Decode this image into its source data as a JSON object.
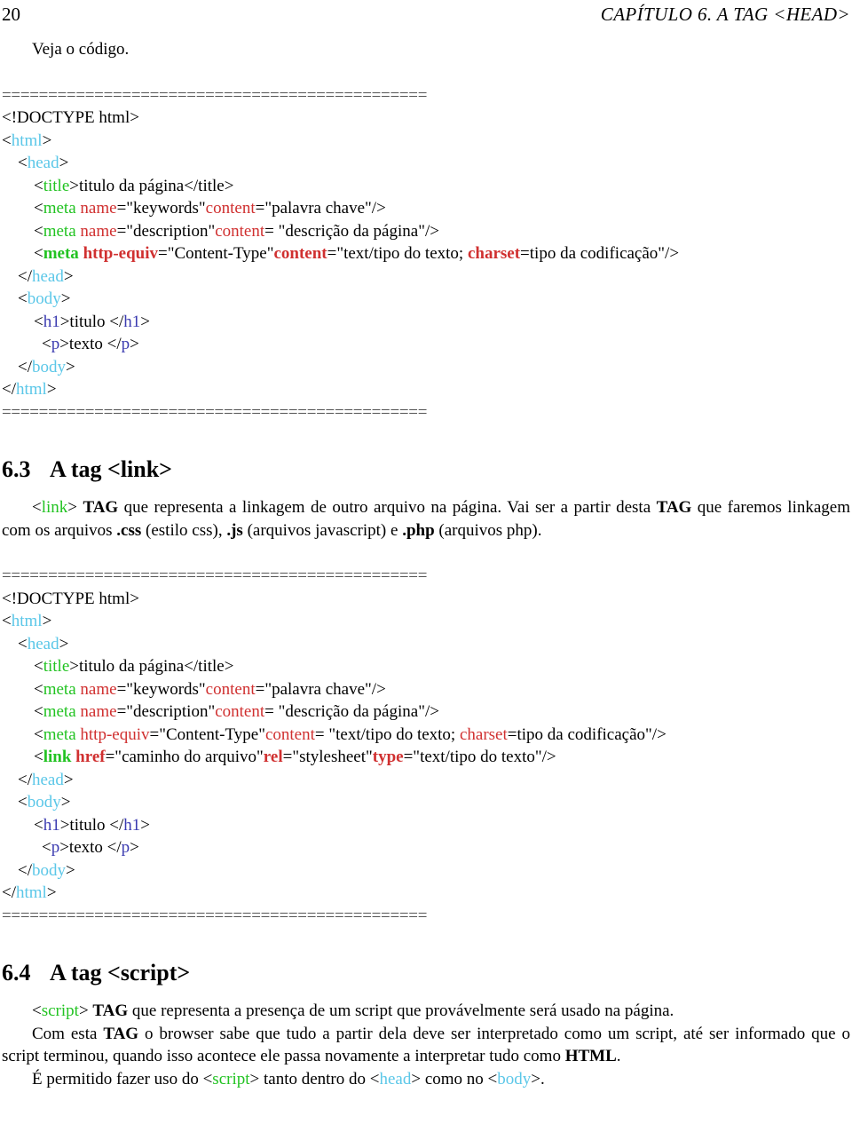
{
  "header": {
    "folio": "20",
    "chapter_title": "CAPÍTULO 6.  A TAG <HEAD>"
  },
  "intro": {
    "text": "Veja o código."
  },
  "separator": "==============================================",
  "code_block_1": {
    "lines": [
      {
        "indent": 0,
        "segments": [
          {
            "text": "<!DOCTYPE html>",
            "color": "black",
            "bold": false
          }
        ]
      },
      {
        "indent": 0,
        "segments": [
          {
            "text": "<",
            "color": "black",
            "bold": false
          },
          {
            "text": "html",
            "color": "cyan",
            "bold": false
          },
          {
            "text": ">",
            "color": "black",
            "bold": false
          }
        ]
      },
      {
        "indent": 1,
        "segments": [
          {
            "text": "<",
            "color": "black",
            "bold": false
          },
          {
            "text": "head",
            "color": "cyan",
            "bold": false
          },
          {
            "text": ">",
            "color": "black",
            "bold": false
          }
        ]
      },
      {
        "indent": 2,
        "segments": [
          {
            "text": "<",
            "color": "black",
            "bold": false
          },
          {
            "text": "title",
            "color": "green",
            "bold": false
          },
          {
            "text": ">titulo da página</title>",
            "color": "black",
            "bold": false
          }
        ]
      },
      {
        "indent": 2,
        "segments": [
          {
            "text": "<",
            "color": "black",
            "bold": false
          },
          {
            "text": "meta ",
            "color": "green",
            "bold": false
          },
          {
            "text": "name",
            "color": "red",
            "bold": false
          },
          {
            "text": "=\"keywords\"",
            "color": "black",
            "bold": false
          },
          {
            "text": "content",
            "color": "red",
            "bold": false
          },
          {
            "text": "=\"palavra chave\"/>",
            "color": "black",
            "bold": false
          }
        ]
      },
      {
        "indent": 2,
        "segments": [
          {
            "text": "<",
            "color": "black",
            "bold": false
          },
          {
            "text": "meta ",
            "color": "green",
            "bold": false
          },
          {
            "text": "name",
            "color": "red",
            "bold": false
          },
          {
            "text": "=\"description\"",
            "color": "black",
            "bold": false
          },
          {
            "text": "content",
            "color": "red",
            "bold": false
          },
          {
            "text": "= \"descrição da página\"/>",
            "color": "black",
            "bold": false
          }
        ]
      },
      {
        "indent": 2,
        "segments": [
          {
            "text": "<",
            "color": "black",
            "bold": false
          },
          {
            "text": "meta ",
            "color": "green",
            "bold": true
          },
          {
            "text": "http-equiv",
            "color": "red",
            "bold": true
          },
          {
            "text": "=\"Content-Type\"",
            "color": "black",
            "bold": false
          },
          {
            "text": "content",
            "color": "red",
            "bold": true
          },
          {
            "text": "=\"text/tipo do texto; ",
            "color": "black",
            "bold": false
          },
          {
            "text": "charset",
            "color": "red",
            "bold": true
          },
          {
            "text": "=tipo da codificação\"/>",
            "color": "black",
            "bold": false
          }
        ]
      },
      {
        "indent": 1,
        "segments": [
          {
            "text": "</",
            "color": "black",
            "bold": false
          },
          {
            "text": "head",
            "color": "cyan",
            "bold": false
          },
          {
            "text": ">",
            "color": "black",
            "bold": false
          }
        ]
      },
      {
        "indent": 1,
        "segments": [
          {
            "text": "<",
            "color": "black",
            "bold": false
          },
          {
            "text": "body",
            "color": "cyan",
            "bold": false
          },
          {
            "text": ">",
            "color": "black",
            "bold": false
          }
        ]
      },
      {
        "indent": 2,
        "segments": [
          {
            "text": "<",
            "color": "black",
            "bold": false
          },
          {
            "text": "h1",
            "color": "blue",
            "bold": false
          },
          {
            "text": ">titulo </",
            "color": "black",
            "bold": false
          },
          {
            "text": "h1",
            "color": "blue",
            "bold": false
          },
          {
            "text": ">",
            "color": "black",
            "bold": false
          }
        ]
      },
      {
        "indent": 2.5,
        "segments": [
          {
            "text": "<",
            "color": "black",
            "bold": false
          },
          {
            "text": "p",
            "color": "blue",
            "bold": false
          },
          {
            "text": ">texto </",
            "color": "black",
            "bold": false
          },
          {
            "text": "p",
            "color": "blue",
            "bold": false
          },
          {
            "text": ">",
            "color": "black",
            "bold": false
          }
        ]
      },
      {
        "indent": 1,
        "segments": [
          {
            "text": "</",
            "color": "black",
            "bold": false
          },
          {
            "text": "body",
            "color": "cyan",
            "bold": false
          },
          {
            "text": ">",
            "color": "black",
            "bold": false
          }
        ]
      },
      {
        "indent": 0,
        "segments": [
          {
            "text": "</",
            "color": "black",
            "bold": false
          },
          {
            "text": "html",
            "color": "cyan",
            "bold": false
          },
          {
            "text": ">",
            "color": "black",
            "bold": false
          }
        ]
      }
    ]
  },
  "section_63": {
    "number": "6.3",
    "title": "A tag <link>",
    "paragraph": [
      {
        "text": "<",
        "color": "black",
        "bold": false
      },
      {
        "text": "link",
        "color": "green",
        "bold": false
      },
      {
        "text": "> ",
        "color": "black",
        "bold": false
      },
      {
        "text": "TAG",
        "color": "black",
        "bold": true
      },
      {
        "text": " que representa a linkagem de outro arquivo na página. Vai ser a partir desta ",
        "color": "black",
        "bold": false
      },
      {
        "text": "TAG",
        "color": "black",
        "bold": true
      },
      {
        "text": " que faremos linkagem com os arquivos ",
        "color": "black",
        "bold": false
      },
      {
        "text": ".css",
        "color": "black",
        "bold": true
      },
      {
        "text": " (estilo css), ",
        "color": "black",
        "bold": false
      },
      {
        "text": ".js",
        "color": "black",
        "bold": true
      },
      {
        "text": " (arquivos javascript) e ",
        "color": "black",
        "bold": false
      },
      {
        "text": ".php",
        "color": "black",
        "bold": true
      },
      {
        "text": " (arquivos php).",
        "color": "black",
        "bold": false
      }
    ]
  },
  "code_block_2": {
    "lines": [
      {
        "indent": 0,
        "segments": [
          {
            "text": "<!DOCTYPE html>",
            "color": "black",
            "bold": false
          }
        ]
      },
      {
        "indent": 0,
        "segments": [
          {
            "text": "<",
            "color": "black",
            "bold": false
          },
          {
            "text": "html",
            "color": "cyan",
            "bold": false
          },
          {
            "text": ">",
            "color": "black",
            "bold": false
          }
        ]
      },
      {
        "indent": 1,
        "segments": [
          {
            "text": "<",
            "color": "black",
            "bold": false
          },
          {
            "text": "head",
            "color": "cyan",
            "bold": false
          },
          {
            "text": ">",
            "color": "black",
            "bold": false
          }
        ]
      },
      {
        "indent": 2,
        "segments": [
          {
            "text": "<",
            "color": "black",
            "bold": false
          },
          {
            "text": "title",
            "color": "green",
            "bold": false
          },
          {
            "text": ">titulo da página</title>",
            "color": "black",
            "bold": false
          }
        ]
      },
      {
        "indent": 2,
        "segments": [
          {
            "text": "<",
            "color": "black",
            "bold": false
          },
          {
            "text": "meta ",
            "color": "green",
            "bold": false
          },
          {
            "text": "name",
            "color": "red",
            "bold": false
          },
          {
            "text": "=\"keywords\"",
            "color": "black",
            "bold": false
          },
          {
            "text": "content",
            "color": "red",
            "bold": false
          },
          {
            "text": "=\"palavra chave\"/>",
            "color": "black",
            "bold": false
          }
        ]
      },
      {
        "indent": 2,
        "segments": [
          {
            "text": "<",
            "color": "black",
            "bold": false
          },
          {
            "text": "meta ",
            "color": "green",
            "bold": false
          },
          {
            "text": "name",
            "color": "red",
            "bold": false
          },
          {
            "text": "=\"description\"",
            "color": "black",
            "bold": false
          },
          {
            "text": "content",
            "color": "red",
            "bold": false
          },
          {
            "text": "= \"descrição da página\"/>",
            "color": "black",
            "bold": false
          }
        ]
      },
      {
        "indent": 2,
        "segments": [
          {
            "text": "<",
            "color": "black",
            "bold": false
          },
          {
            "text": "meta ",
            "color": "green",
            "bold": false
          },
          {
            "text": "http-equiv",
            "color": "red",
            "bold": false
          },
          {
            "text": "=\"Content-Type\"",
            "color": "black",
            "bold": false
          },
          {
            "text": "content",
            "color": "red",
            "bold": false
          },
          {
            "text": "= \"text/tipo do texto; ",
            "color": "black",
            "bold": false
          },
          {
            "text": "charset",
            "color": "red",
            "bold": false
          },
          {
            "text": "=tipo da codificação\"/>",
            "color": "black",
            "bold": false
          }
        ]
      },
      {
        "indent": 2,
        "segments": [
          {
            "text": "<",
            "color": "black",
            "bold": false
          },
          {
            "text": "link ",
            "color": "green",
            "bold": true
          },
          {
            "text": "href",
            "color": "red",
            "bold": true
          },
          {
            "text": "=\"caminho do arquivo\"",
            "color": "black",
            "bold": false
          },
          {
            "text": "rel",
            "color": "red",
            "bold": true
          },
          {
            "text": "=\"stylesheet\"",
            "color": "black",
            "bold": false
          },
          {
            "text": "type",
            "color": "red",
            "bold": true
          },
          {
            "text": "=\"text/tipo do texto\"/>",
            "color": "black",
            "bold": false
          }
        ]
      },
      {
        "indent": 1,
        "segments": [
          {
            "text": "</",
            "color": "black",
            "bold": false
          },
          {
            "text": "head",
            "color": "cyan",
            "bold": false
          },
          {
            "text": ">",
            "color": "black",
            "bold": false
          }
        ]
      },
      {
        "indent": 1,
        "segments": [
          {
            "text": "<",
            "color": "black",
            "bold": false
          },
          {
            "text": "body",
            "color": "cyan",
            "bold": false
          },
          {
            "text": ">",
            "color": "black",
            "bold": false
          }
        ]
      },
      {
        "indent": 2,
        "segments": [
          {
            "text": "<",
            "color": "black",
            "bold": false
          },
          {
            "text": "h1",
            "color": "blue",
            "bold": false
          },
          {
            "text": ">titulo </",
            "color": "black",
            "bold": false
          },
          {
            "text": "h1",
            "color": "blue",
            "bold": false
          },
          {
            "text": ">",
            "color": "black",
            "bold": false
          }
        ]
      },
      {
        "indent": 2.5,
        "segments": [
          {
            "text": "<",
            "color": "black",
            "bold": false
          },
          {
            "text": "p",
            "color": "blue",
            "bold": false
          },
          {
            "text": ">texto </",
            "color": "black",
            "bold": false
          },
          {
            "text": "p",
            "color": "blue",
            "bold": false
          },
          {
            "text": ">",
            "color": "black",
            "bold": false
          }
        ]
      },
      {
        "indent": 1,
        "segments": [
          {
            "text": "</",
            "color": "black",
            "bold": false
          },
          {
            "text": "body",
            "color": "cyan",
            "bold": false
          },
          {
            "text": ">",
            "color": "black",
            "bold": false
          }
        ]
      },
      {
        "indent": 0,
        "segments": [
          {
            "text": "</",
            "color": "black",
            "bold": false
          },
          {
            "text": "html",
            "color": "cyan",
            "bold": false
          },
          {
            "text": ">",
            "color": "black",
            "bold": false
          }
        ]
      }
    ]
  },
  "section_64": {
    "number": "6.4",
    "title": "A tag <script>",
    "paragraph_1": [
      {
        "text": "<",
        "color": "black",
        "bold": false
      },
      {
        "text": "script",
        "color": "green",
        "bold": false
      },
      {
        "text": "> ",
        "color": "black",
        "bold": false
      },
      {
        "text": "TAG",
        "color": "black",
        "bold": true
      },
      {
        "text": " que representa a presença de um script que provávelmente será usado na página.",
        "color": "black",
        "bold": false
      }
    ],
    "paragraph_2": [
      {
        "text": "Com esta ",
        "color": "black",
        "bold": false
      },
      {
        "text": "TAG",
        "color": "black",
        "bold": true
      },
      {
        "text": " o browser sabe que tudo a partir dela deve ser interpretado como um script, até ser informado que o script terminou, quando isso acontece ele passa novamente a interpretar tudo como ",
        "color": "black",
        "bold": false
      },
      {
        "text": "HTML",
        "color": "black",
        "bold": true
      },
      {
        "text": ".",
        "color": "black",
        "bold": false
      }
    ],
    "paragraph_3": [
      {
        "text": "É permitido fazer uso do <",
        "color": "black",
        "bold": false
      },
      {
        "text": "script",
        "color": "green",
        "bold": false
      },
      {
        "text": "> tanto dentro do <",
        "color": "black",
        "bold": false
      },
      {
        "text": "head",
        "color": "cyan",
        "bold": false
      },
      {
        "text": "> como no <",
        "color": "black",
        "bold": false
      },
      {
        "text": "body",
        "color": "cyan",
        "bold": false
      },
      {
        "text": ">.",
        "color": "black",
        "bold": false
      }
    ]
  },
  "colors": {
    "tag_structural": "#5BC7E8",
    "tag_meta": "#22C322",
    "attribute": "#D03030",
    "tag_content": "#3B3BB0",
    "separator": "#555555",
    "text": "#000000"
  }
}
